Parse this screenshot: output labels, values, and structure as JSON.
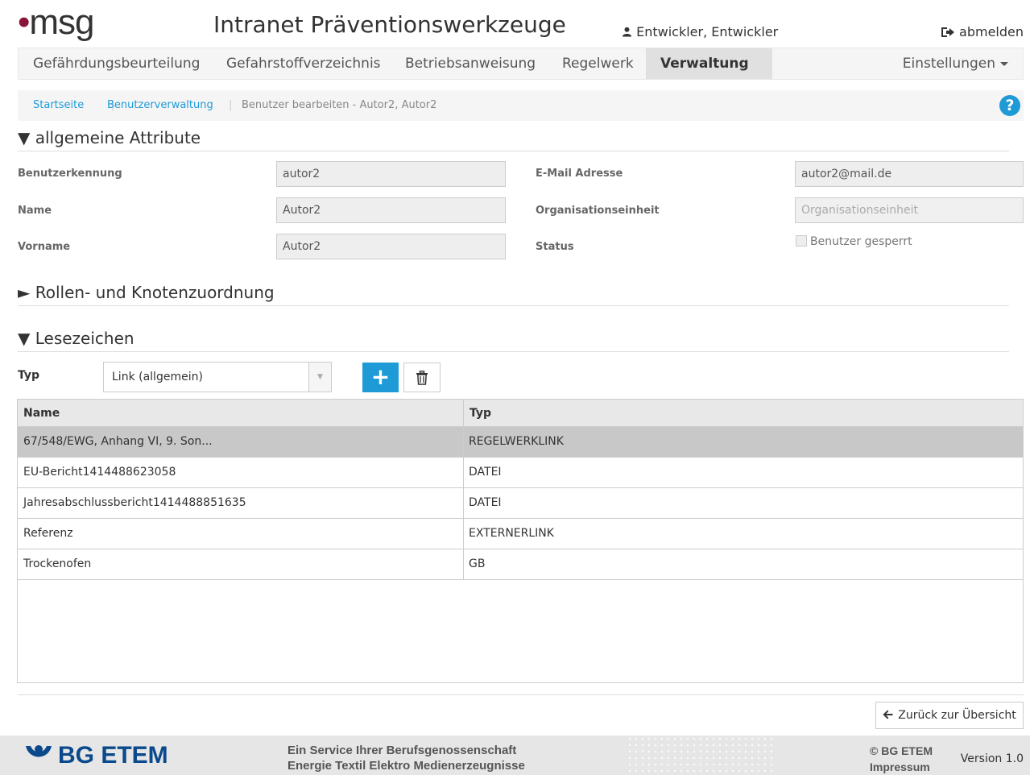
{
  "header": {
    "logo": "msg",
    "logo_dot": "•",
    "title": "Intranet Präventionswerkzeuge",
    "user": "Entwickler, Entwickler",
    "logout": "abmelden"
  },
  "nav": {
    "items": [
      "Gefährdungsbeurteilung",
      "Gefahrstoffverzeichnis",
      "Betriebsanweisung",
      "Regelwerk",
      "Verwaltung"
    ],
    "settings": "Einstellungen"
  },
  "breadcrumb": {
    "home": "Startseite",
    "users": "Benutzerverwaltung",
    "separator": "|",
    "current": "Benutzer bearbeiten - Autor2, Autor2",
    "help": "?"
  },
  "general": {
    "heading": "▼ allgemeine Attribute",
    "labels": {
      "login": "Benutzerkennung",
      "name": "Name",
      "firstname": "Vorname",
      "email": "E-Mail Adresse",
      "orgunit": "Organisationseinheit",
      "status": "Status"
    },
    "values": {
      "login": "autor2",
      "name": "Autor2",
      "firstname": "Autor2",
      "email": "autor2@mail.de",
      "orgunit_placeholder": "Organisationseinheit"
    },
    "locked_label": "Benutzer gesperrt",
    "locked": false
  },
  "roles": {
    "heading": "► Rollen- und Knotenzuordnung"
  },
  "bookmarks": {
    "heading": "▼ Lesezeichen",
    "type_label": "Typ",
    "type_selected": "Link (allgemein)",
    "add": "+",
    "columns": [
      "Name",
      "Typ"
    ],
    "rows": [
      {
        "name": "67/548/EWG, Anhang VI, 9. Son...",
        "type": "REGELWERKLINK"
      },
      {
        "name": "EU-Bericht1414488623058",
        "type": "DATEI"
      },
      {
        "name": "Jahresabschlussbericht1414488851635",
        "type": "DATEI"
      },
      {
        "name": "Referenz",
        "type": "EXTERNERLINK"
      },
      {
        "name": "Trockenofen",
        "type": "GB"
      }
    ]
  },
  "back_button": "Zurück zur Übersicht",
  "footer": {
    "logo": "BG ETEM",
    "service_line1": "Ein Service Ihrer Berufsgenossenschaft",
    "service_line2": "Energie Textil Elektro Medienerzeugnisse",
    "copyright": "© BG ETEM",
    "impressum": "Impressum",
    "version": "Version 1.0"
  },
  "colors": {
    "accent": "#1e9bd7",
    "logo_dot": "#8b1538",
    "footer_logo": "#0a4a8c"
  }
}
